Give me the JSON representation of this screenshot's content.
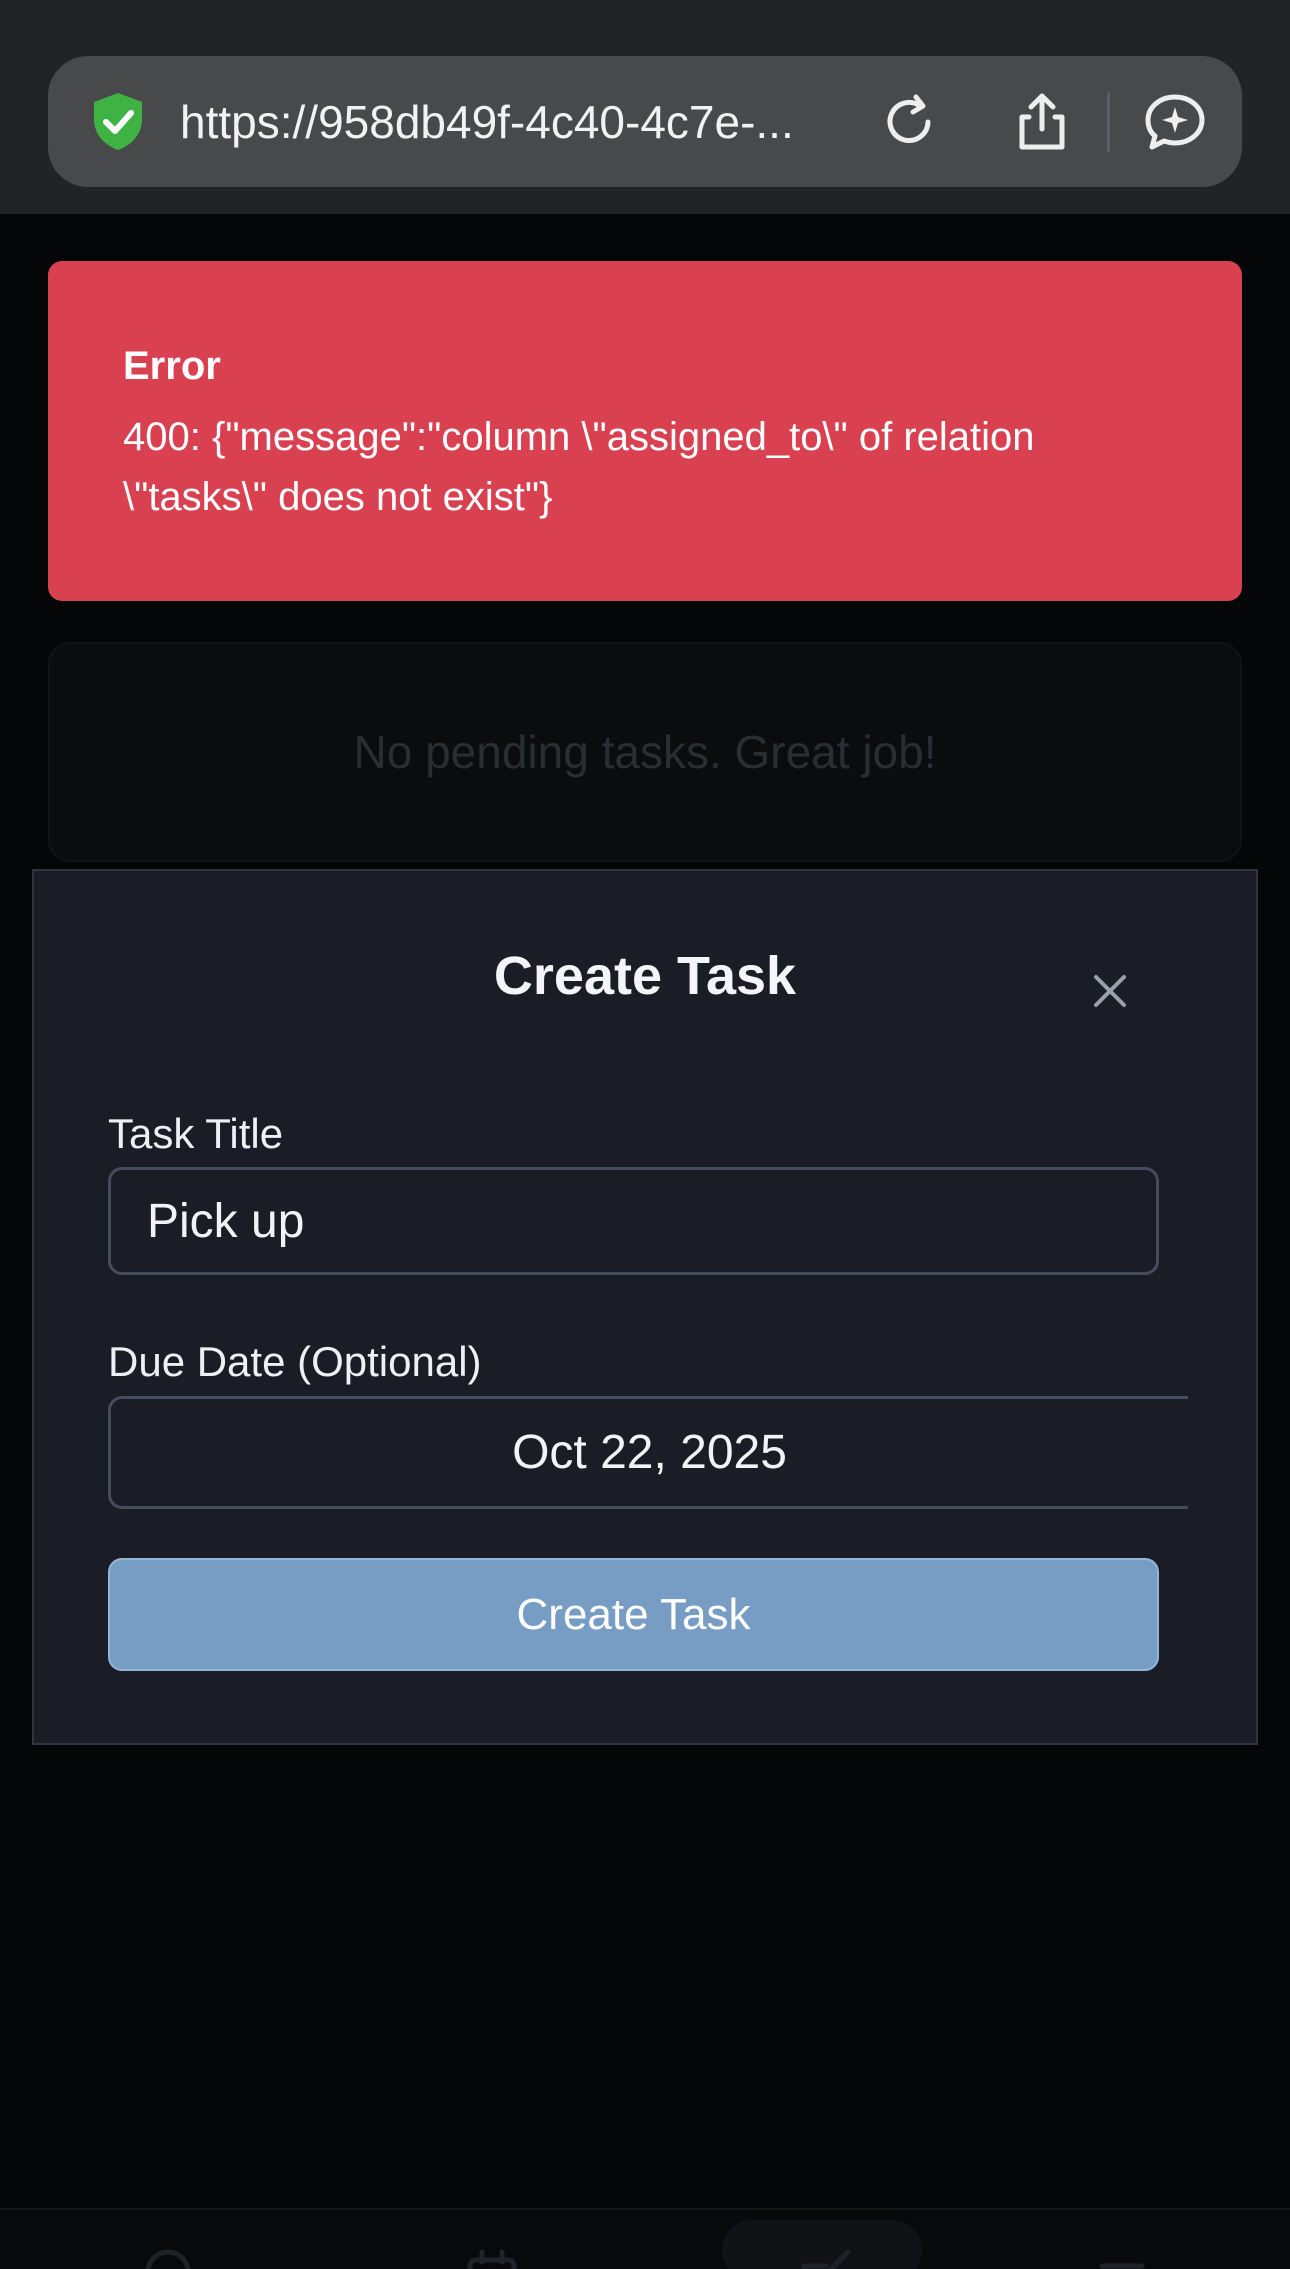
{
  "browser": {
    "url": "https://958db49f-4c40-4c7e-...",
    "icons": [
      "shield-check-icon",
      "reload-icon",
      "share-icon",
      "assistant-icon"
    ]
  },
  "error_alert": {
    "title": "Error",
    "message": "400: {\"message\":\"column \\\"assigned_to\\\" of relation \\\"tasks\\\" does not exist\"}"
  },
  "tasks": {
    "empty_message": "No pending tasks. Great job!"
  },
  "modal": {
    "title": "Create Task",
    "close_icon": "close-icon",
    "title_field": {
      "label": "Task Title",
      "value": "Pick up"
    },
    "due_date_field": {
      "label": "Due Date (Optional)",
      "value": "Oct 22, 2025"
    },
    "submit_label": "Create Task"
  },
  "bottom_nav": {
    "icons": [
      "search-icon",
      "calendar-icon",
      "edit-icon",
      "menu-icon"
    ]
  },
  "colors": {
    "error_bg": "#d94150",
    "modal_bg": "#1a1d26",
    "primary_button": "#779dc5",
    "shield_green": "#3fb244"
  }
}
